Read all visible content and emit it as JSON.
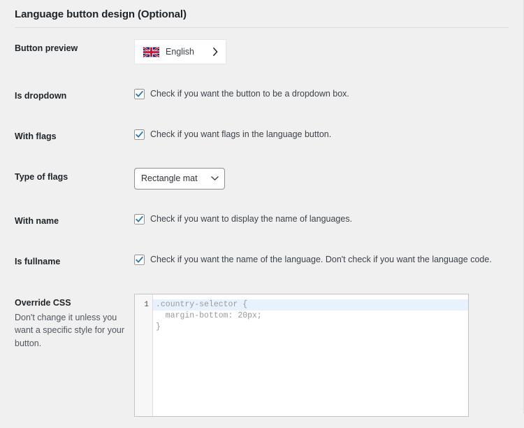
{
  "panel": {
    "title": "Language button design (Optional)"
  },
  "rows": [
    {
      "label": "Button preview",
      "type": "preview"
    },
    {
      "label": "Is dropdown",
      "type": "checkbox",
      "checked": true,
      "text": "Check if you want the button to be a dropdown box."
    },
    {
      "label": "With flags",
      "type": "checkbox",
      "checked": true,
      "text": "Check if you want flags in the language button."
    },
    {
      "label": "Type of flags",
      "type": "select",
      "value": "Rectangle mat",
      "options": [
        "Rectangle mat"
      ]
    },
    {
      "label": "With name",
      "type": "checkbox",
      "checked": true,
      "text": "Check if you want to display the name of languages."
    },
    {
      "label": "Is fullname",
      "type": "checkbox",
      "checked": true,
      "text": "Check if you want the name of the language. Don't check if you want the language code."
    },
    {
      "label": "Override CSS",
      "sub": "Don't change it unless you want a specific style for your button.",
      "type": "editor"
    }
  ],
  "preview": {
    "flag_icon": "uk-flag-icon",
    "language": "English",
    "chevron_icon": "chevron-right-icon"
  },
  "select_icon": "chevron-down-icon",
  "editor": {
    "line_numbers": [
      "1"
    ],
    "lines": [
      ".country-selector {",
      "  margin-bottom: 20px;",
      "}"
    ],
    "active_line_index": 0
  },
  "colors": {
    "page_background": "#f0f0f1",
    "checkbox_accent": "#2271b1",
    "active_line": "#e8f2fe",
    "text": "#1d2327",
    "muted_text": "#3c434a"
  }
}
